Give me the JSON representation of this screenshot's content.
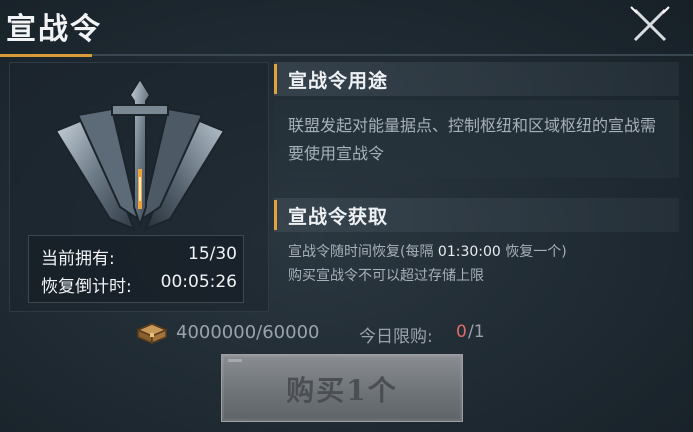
{
  "window": {
    "title": "宣战令"
  },
  "stats": {
    "owned_label": "当前拥有:",
    "owned_value": "15/30",
    "countdown_label": "恢复倒计时:",
    "countdown_value": "00:05:26"
  },
  "usage": {
    "heading": "宣战令用途",
    "description": "联盟发起对能量据点、控制枢纽和区域枢纽的宣战需要使用宣战令"
  },
  "acquire": {
    "heading": "宣战令获取",
    "line1_prefix": "宣战令随时间恢复(每隔",
    "line1_interval": "01:30:00",
    "line1_suffix": "恢复一个)",
    "line2": "购买宣战令不可以超过存储上限"
  },
  "currency": {
    "amount": "4000000/60000",
    "icon": "treasure-chest-icon"
  },
  "daily_limit": {
    "label": "今日限购:",
    "current": "0",
    "max": "/1"
  },
  "buy_button": {
    "label": "购买1个"
  },
  "colors": {
    "accent": "#e2a33d",
    "limit_current": "#e06a6a"
  }
}
